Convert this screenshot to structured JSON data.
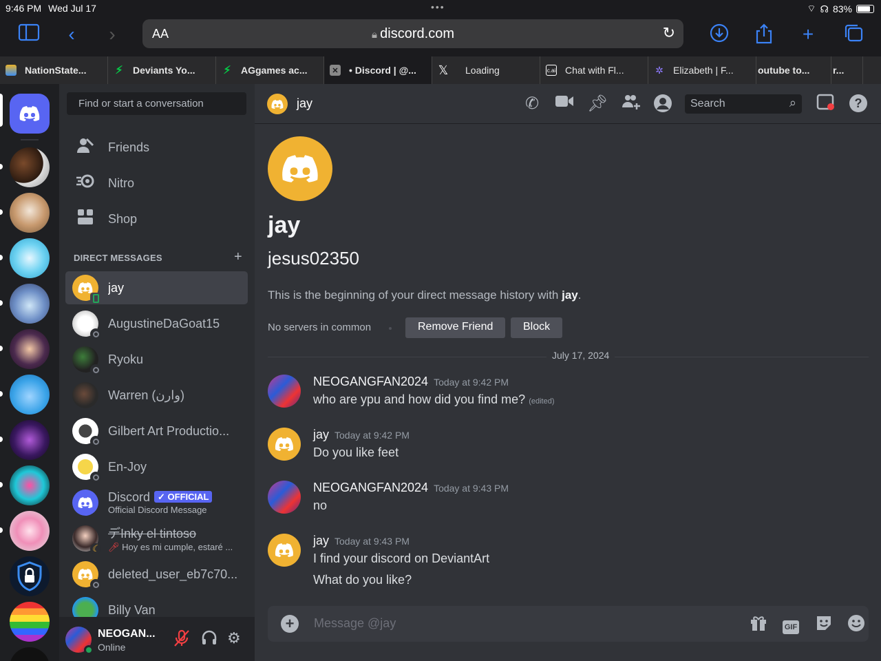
{
  "status_bar": {
    "time": "9:46 PM",
    "date": "Wed Jul 17",
    "battery": "83%",
    "battery_level": 0.83
  },
  "browser": {
    "text_size": "AA",
    "url": "discord.com"
  },
  "tabs": [
    {
      "label": "NationState..."
    },
    {
      "label": "Deviants Yo..."
    },
    {
      "label": "AGgames ac..."
    },
    {
      "label": "• Discord | @..."
    },
    {
      "label": "Loading"
    },
    {
      "label": "Chat with Fl..."
    },
    {
      "label": "Elizabeth | F..."
    },
    {
      "label": "outube to..."
    },
    {
      "label": "r..."
    }
  ],
  "sidebar": {
    "find_placeholder": "Find or start a conversation",
    "nav": [
      {
        "label": "Friends"
      },
      {
        "label": "Nitro"
      },
      {
        "label": "Shop"
      }
    ],
    "dm_header": "DIRECT MESSAGES",
    "dms": [
      {
        "name": "jay"
      },
      {
        "name": "AugustineDaGoat15"
      },
      {
        "name": "Ryoku"
      },
      {
        "name": "Warren (وارن)"
      },
      {
        "name": "Gilbert Art Productio..."
      },
      {
        "name": "En-Joy"
      },
      {
        "name": "Discord",
        "badge": "OFFICIAL",
        "sub": "Official Discord Message"
      },
      {
        "name": "デInky el tintoso",
        "sub": "Hoy es mi cumple, estaré ..."
      },
      {
        "name": "deleted_user_eb7c70..."
      },
      {
        "name": "Billy Van"
      }
    ]
  },
  "user_panel": {
    "name": "NEOGAN...",
    "status": "Online"
  },
  "channel": {
    "name": "jay",
    "search_placeholder": "Search",
    "display_name": "jay",
    "username": "jesus02350",
    "beginning_text": "This is the beginning of your direct message history with ",
    "beginning_name": "jay",
    "beginning_end": ".",
    "no_servers": "No servers in common",
    "remove_friend": "Remove Friend",
    "block": "Block",
    "date_divider": "July 17, 2024",
    "composer_placeholder": "Message @jay",
    "gif_label": "GIF"
  },
  "messages": [
    {
      "author": "NEOGANGFAN2024",
      "time": "Today at 9:42 PM",
      "lines": [
        "who are ypu and how did you find me?"
      ],
      "edited": "(edited)"
    },
    {
      "author": "jay",
      "time": "Today at 9:42 PM",
      "lines": [
        "Do you like feet"
      ]
    },
    {
      "author": "NEOGANGFAN2024",
      "time": "Today at 9:43 PM",
      "lines": [
        "no"
      ]
    },
    {
      "author": "jay",
      "time": "Today at 9:43 PM",
      "lines": [
        "I find your discord on DeviantArt",
        "What do you like?"
      ]
    }
  ],
  "colors": {
    "accent": "#5865f2",
    "online": "#23a559",
    "jay_avatar": "#f0b232"
  }
}
